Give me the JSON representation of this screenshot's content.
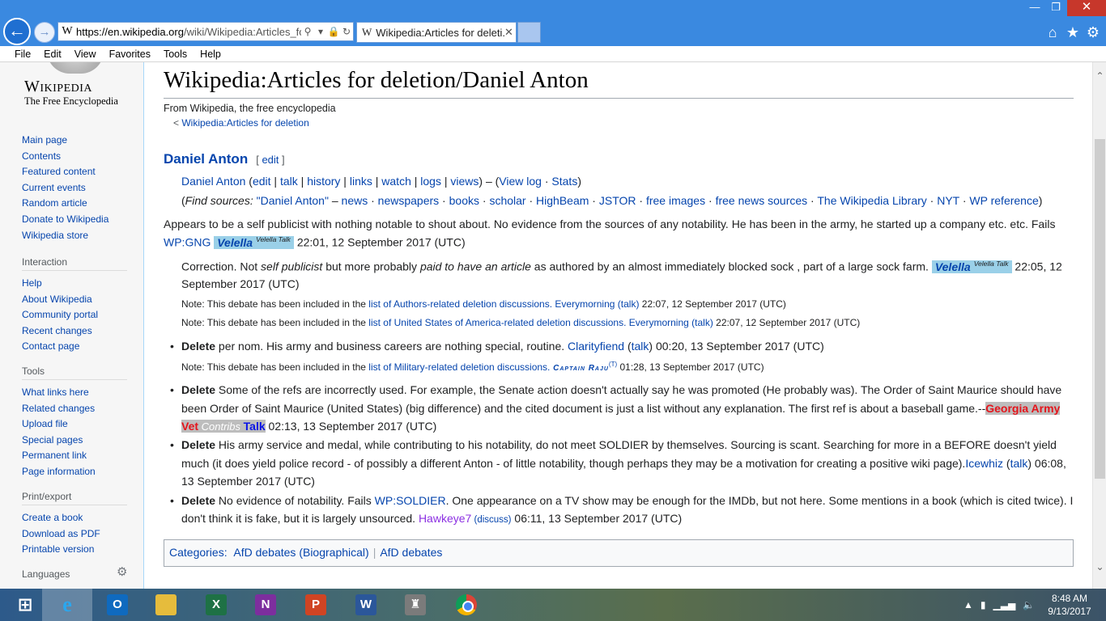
{
  "browser": {
    "url_domain": "https://en.wikipedia.org",
    "url_rest": "/wiki/Wikipedia:Articles_fo",
    "tab_title": "Wikipedia:Articles for deleti...",
    "menu": [
      "File",
      "Edit",
      "View",
      "Favorites",
      "Tools",
      "Help"
    ]
  },
  "sidebar": {
    "logo_word": "Wikipedia",
    "logo_tagline": "The Free Encyclopedia",
    "main": [
      "Main page",
      "Contents",
      "Featured content",
      "Current events",
      "Random article",
      "Donate to Wikipedia",
      "Wikipedia store"
    ],
    "interaction_head": "Interaction",
    "interaction": [
      "Help",
      "About Wikipedia",
      "Community portal",
      "Recent changes",
      "Contact page"
    ],
    "tools_head": "Tools",
    "tools": [
      "What links here",
      "Related changes",
      "Upload file",
      "Special pages",
      "Permanent link",
      "Page information"
    ],
    "print_head": "Print/export",
    "print": [
      "Create a book",
      "Download as PDF",
      "Printable version"
    ],
    "languages_head": "Languages"
  },
  "page": {
    "title": "Wikipedia:Articles for deletion/Daniel Anton",
    "subtitle": "From Wikipedia, the free encyclopedia",
    "crumb_prefix": "< ",
    "crumb_link": "Wikipedia:Articles for deletion",
    "section": "Daniel Anton",
    "section_edit": "[ edit ]"
  },
  "links_line": {
    "article": "Daniel Anton",
    "p1": " (",
    "edit": "edit",
    "s1": " | ",
    "talk": "talk",
    "history": "history",
    "links": "links",
    "watch": "watch",
    "logs": "logs",
    "views": "views",
    "p2": ") – (",
    "viewlog": "View log",
    "dot": " · ",
    "stats": "Stats",
    "p3": ")"
  },
  "find_line": {
    "open": "(",
    "label": "Find sources:",
    "query": " \"Daniel Anton\"",
    "dash": " – ",
    "items": [
      "news",
      "newspapers",
      "books",
      "scholar",
      "HighBeam",
      "JSTOR",
      "free images",
      "free news sources",
      "The Wikipedia Library",
      "NYT",
      "WP reference"
    ],
    "sep": " · ",
    "close": ")"
  },
  "nomination": {
    "text1": "Appears to be a self publicist with nothing notable to shout about. No evidence from the sources of any notability. He has been in the army, he started up a company etc. etc. Fails",
    "wpgng": "WP:GNG",
    "sig_name": "Velella",
    "sig_sup": "Velella Talk",
    "time": " 22:01, 12 September 2017 (UTC)"
  },
  "correction": {
    "t1": "Correction. Not ",
    "i1": "self publicist",
    "t2": " but more probably ",
    "i2": "paid to have an article",
    "t3": " as authored by an almost immediately blocked sock , part of a large sock farm. ",
    "sig_name": "Velella",
    "sig_sup": "Velella Talk",
    "time_a": " 22:05, 12",
    "time_b": "September 2017 (UTC)"
  },
  "notes": {
    "prefix": "Note: This debate has been included in the ",
    "n1_link": "list of Authors-related deletion discussions.",
    "n1_user": " Everymorning",
    "n1_talk": " (talk)",
    "n1_time": " 22:07, 12 September 2017 (UTC)",
    "n2_link": "list of United States of America-related deletion discussions.",
    "n2_user": " Everymorning",
    "n2_talk": " (talk)",
    "n2_time": " 22:07, 12 September 2017 (UTC)",
    "n3_link": "list of Military-related deletion discussions.",
    "n3_user": " Captain Raju",
    "n3_sup": "(T)",
    "n3_time": " 01:28, 13 September 2017 (UTC)"
  },
  "votes": {
    "delete": "Delete",
    "v1_text": " per nom. His army and business careers are nothing special, routine. ",
    "v1_user": "Clarityfiend",
    "v1_talk": "talk",
    "v1_time": " 00:20, 13 September 2017 (UTC)",
    "v2_text_a": " Some of the refs are incorrectly used. For example, the Senate action doesn't actually say he was promoted (He probably was). The Order of Saint Maurice should have",
    "v2_text_b": "been Order of Saint Maurice (United States) (big difference) and the cited document is just a list without any explanation. The first ref is about a baseball game.--",
    "v2_sig1": "Georgia Army",
    "v2_sig2": "Vet",
    "v2_sig3": " Contribs ",
    "v2_sig4": "Talk",
    "v2_time": " 02:13, 13 September 2017 (UTC)",
    "v3_text_a": " His army service and medal, while contributing to his notability, do not meet SOLDIER by themselves. Sourcing is scant. Searching for more in a BEFORE doesn't yield",
    "v3_text_b": "much (it does yield police record - of possibly a different Anton - of little notability, though perhaps they may be a motivation for creating a positive wiki page).",
    "v3_user": "Icewhiz",
    "v3_talk": "talk",
    "v3_time_a": " 06:08,",
    "v3_time_b": "13 September 2017 (UTC)",
    "v4_text_a": " No evidence of notability. Fails ",
    "v4_link": "WP:SOLDIER",
    "v4_text_b": ". One appearance on a TV show may be enough for the IMDb, but not here. Some mentions in a book (which is cited twice). I",
    "v4_text_c": "don't think it is fake, but it is largely unsourced. ",
    "v4_user": "Hawkeye7",
    "v4_discuss": " (discuss)",
    "v4_time": " 06:11, 13 September 2017 (UTC)"
  },
  "categories": {
    "label": "Categories:",
    "items": [
      "AfD debates (Biographical)",
      "AfD debates"
    ]
  },
  "taskbar": {
    "time": "8:48 AM",
    "date": "9/13/2017"
  },
  "icons": {
    "back": "back-arrow-icon",
    "forward": "forward-arrow-icon",
    "home": "home-icon",
    "favorites": "star-icon",
    "tools": "gear-icon"
  }
}
